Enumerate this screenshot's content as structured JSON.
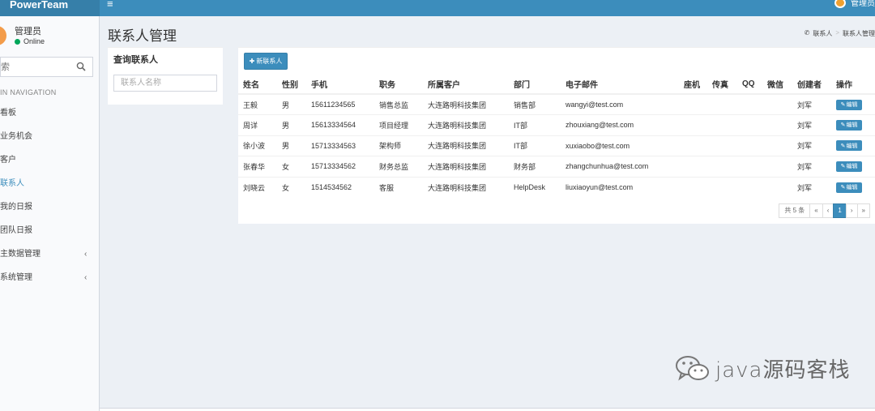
{
  "app": {
    "title": "PowerTeam",
    "menu_icon": "hamburger-icon"
  },
  "header_user": {
    "name": "管理员"
  },
  "sidebar": {
    "user": {
      "name": "管理员",
      "status": "Online"
    },
    "search": {
      "placeholder": "索"
    },
    "nav_header": "IN NAVIGATION",
    "items": [
      {
        "label": "看板"
      },
      {
        "label": "业务机会"
      },
      {
        "label": "客户"
      },
      {
        "label": "联系人",
        "active": true
      },
      {
        "label": "我的日报"
      },
      {
        "label": "团队日报"
      },
      {
        "label": "主数据管理",
        "has_children": true
      },
      {
        "label": "系统管理",
        "has_children": true
      }
    ]
  },
  "page": {
    "title": "联系人管理",
    "breadcrumb": [
      "联系人",
      "联系人管理"
    ]
  },
  "query": {
    "title": "查询联系人",
    "placeholder": "联系人名称"
  },
  "toolbar": {
    "add_label": "新联系人"
  },
  "table": {
    "columns": [
      "姓名",
      "性别",
      "手机",
      "职务",
      "所属客户",
      "部门",
      "电子邮件",
      "座机",
      "传真",
      "QQ",
      "微信",
      "创建者",
      "操作"
    ],
    "rows": [
      {
        "name": "王毅",
        "gender": "男",
        "mobile": "15611234565",
        "title": "销售总监",
        "customer": "大连路明科技集团",
        "dept": "销售部",
        "email": "wangyi@test.com",
        "phone": "",
        "fax": "",
        "qq": "",
        "wechat": "",
        "creator": "刘军",
        "action": "编辑"
      },
      {
        "name": "周详",
        "gender": "男",
        "mobile": "15613334564",
        "title": "项目经理",
        "customer": "大连路明科技集团",
        "dept": "IT部",
        "email": "zhouxiang@test.com",
        "phone": "",
        "fax": "",
        "qq": "",
        "wechat": "",
        "creator": "刘军",
        "action": "编辑"
      },
      {
        "name": "徐小波",
        "gender": "男",
        "mobile": "15713334563",
        "title": "架构师",
        "customer": "大连路明科技集团",
        "dept": "IT部",
        "email": "xuxiaobo@test.com",
        "phone": "",
        "fax": "",
        "qq": "",
        "wechat": "",
        "creator": "刘军",
        "action": "编辑"
      },
      {
        "name": "张春华",
        "gender": "女",
        "mobile": "15713334562",
        "title": "财务总监",
        "customer": "大连路明科技集团",
        "dept": "财务部",
        "email": "zhangchunhua@test.com",
        "phone": "",
        "fax": "",
        "qq": "",
        "wechat": "",
        "creator": "刘军",
        "action": "编辑"
      },
      {
        "name": "刘晓云",
        "gender": "女",
        "mobile": "1514534562",
        "title": "客服",
        "customer": "大连路明科技集团",
        "dept": "HelpDesk",
        "email": "liuxiaoyun@test.com",
        "phone": "",
        "fax": "",
        "qq": "",
        "wechat": "",
        "creator": "刘军",
        "action": "编辑"
      }
    ]
  },
  "pagination": {
    "info": "共 5 条",
    "first": "«",
    "prev": "‹",
    "current": "1",
    "next": "›",
    "last": "»"
  },
  "watermark": {
    "text": "java源码客栈"
  },
  "colors": {
    "primary": "#3c8dbc",
    "logo_bg": "#367fa9",
    "online": "#00a65a",
    "content_bg": "#ecf0f5"
  }
}
